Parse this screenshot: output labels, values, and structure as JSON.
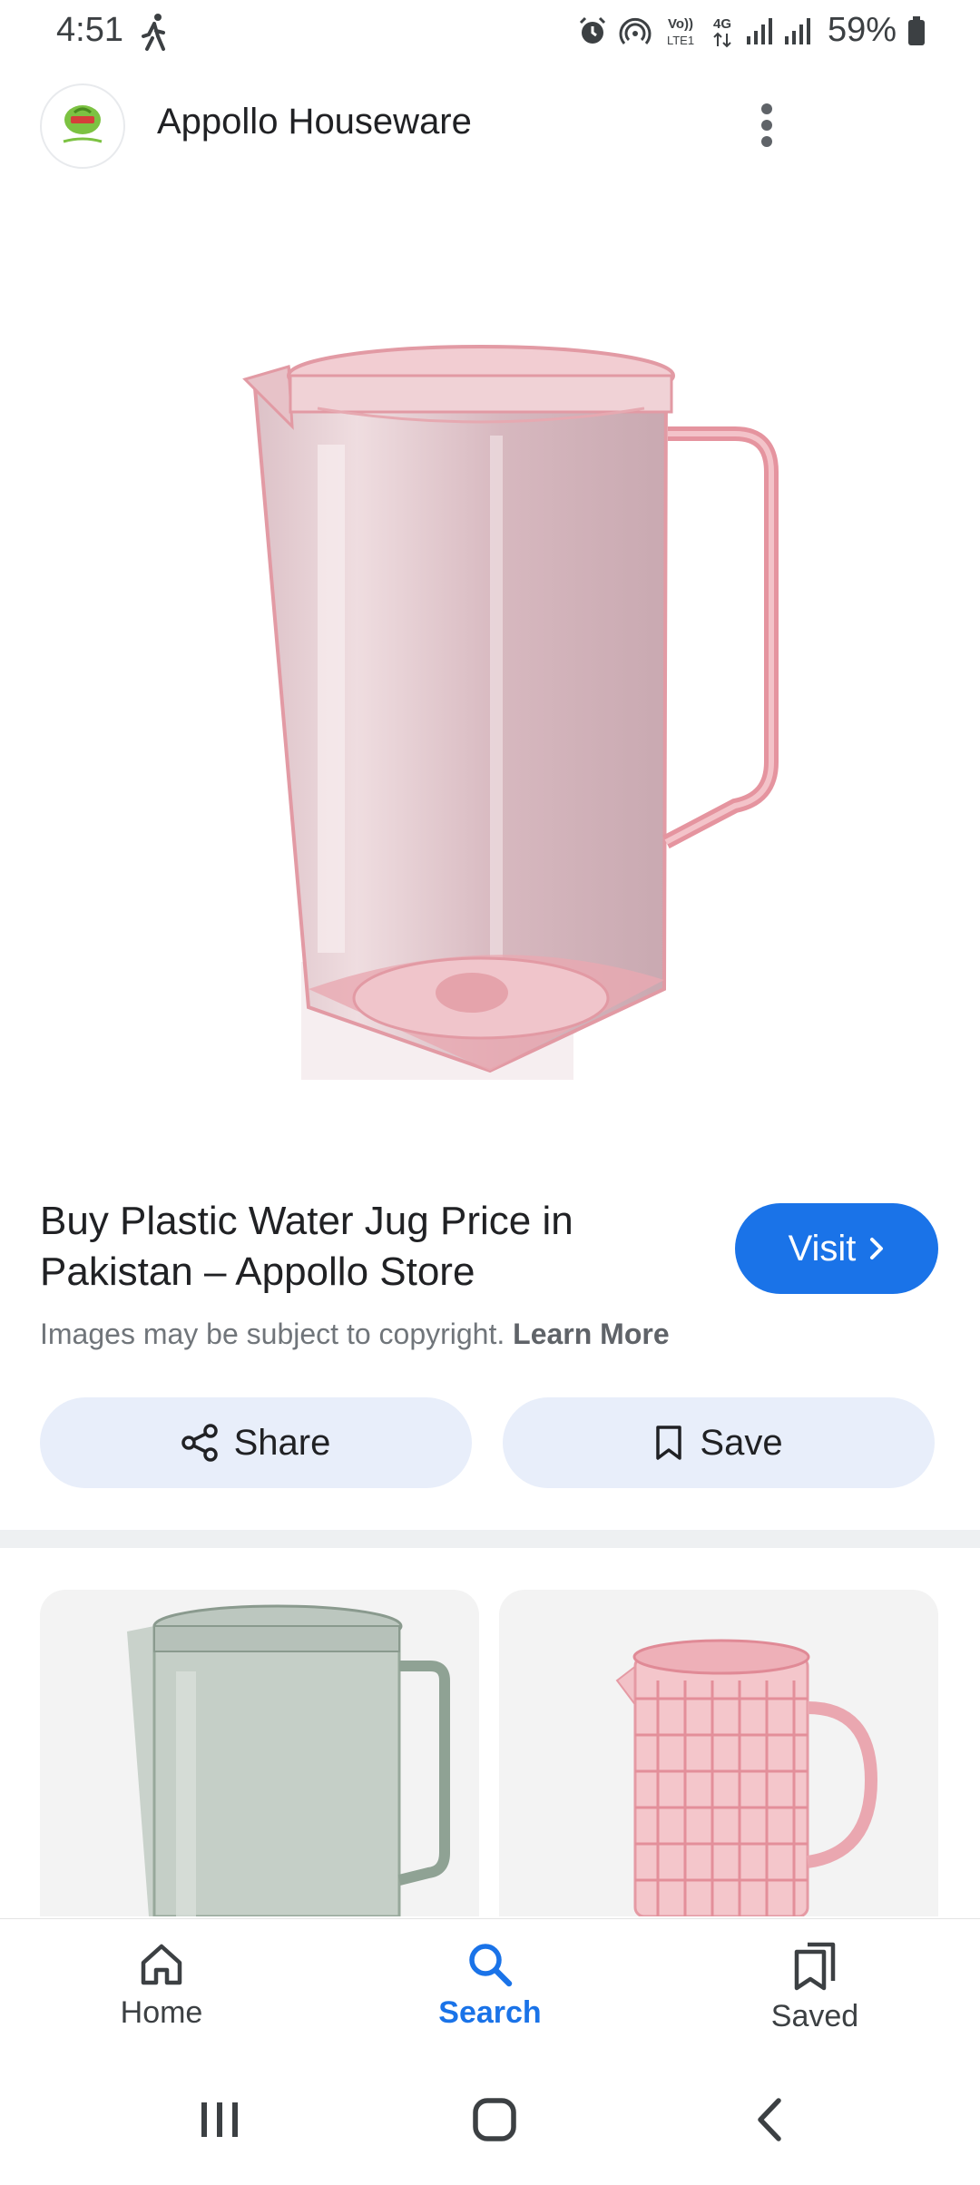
{
  "status_bar": {
    "time": "4:51",
    "battery": "59%",
    "icons": [
      "walking-icon",
      "alarm-icon",
      "hotspot-icon",
      "volte-icon",
      "4g-icon",
      "signal-icon",
      "signal-icon",
      "battery-icon"
    ],
    "volte_label": "VoLTE1",
    "network_label": "4G"
  },
  "header": {
    "site_name": "Appollo Houseware",
    "logo_icon": "appollo-logo-icon",
    "menu_icon": "more-vert-icon"
  },
  "result": {
    "title": "Buy Plastic Water Jug Price in Pakistan – Appollo Store",
    "visit_label": "Visit",
    "copyright_text": "Images may be subject to copyright.",
    "learn_more_label": "Learn More"
  },
  "actions": {
    "share_label": "Share",
    "save_label": "Save"
  },
  "related": [
    {
      "icon": "green-jug-image"
    },
    {
      "icon": "pink-textured-jug-image"
    }
  ],
  "bottom_nav": {
    "items": [
      {
        "label": "Home",
        "icon": "home-icon"
      },
      {
        "label": "Search",
        "icon": "search-icon",
        "active": true
      },
      {
        "label": "Saved",
        "icon": "saved-icon"
      }
    ]
  },
  "system_nav": {
    "icons": [
      "recents-icon",
      "home-button-icon",
      "back-icon"
    ]
  },
  "colors": {
    "accent": "#1a73e8",
    "pill_bg": "#e8eefa",
    "jug_pink": "#e9a4ab"
  }
}
